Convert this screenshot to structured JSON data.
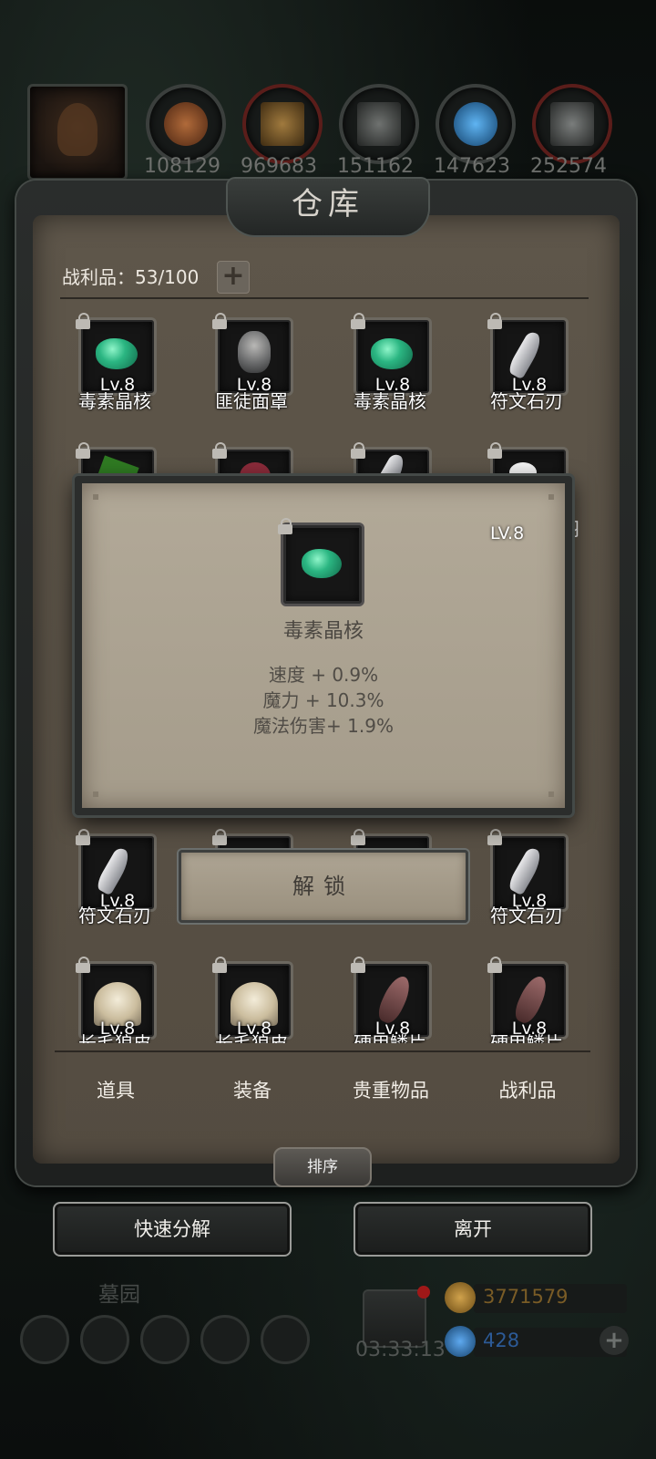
{
  "resources": [
    {
      "value": "108129",
      "color": "#8a4a26"
    },
    {
      "value": "969683",
      "color": "#8a6a34"
    },
    {
      "value": "151162",
      "color": "#555856"
    },
    {
      "value": "147623",
      "color": "#2a6fa8"
    },
    {
      "value": "252574",
      "color": "#4a4d4c"
    }
  ],
  "warehouse": {
    "title": "仓库",
    "capacity_label": "战利品：53/100",
    "add_capacity": "+"
  },
  "grid": {
    "rows": [
      {
        "items": [
          {
            "name": "毒素晶核",
            "level": "Lv.8",
            "type": "gem"
          },
          {
            "name": "匪徒面罩",
            "level": "Lv.8",
            "type": "mask"
          },
          {
            "name": "毒素晶核",
            "level": "Lv.8",
            "type": "gem"
          },
          {
            "name": "符文石刃",
            "level": "Lv.8",
            "type": "blade"
          }
        ]
      },
      {
        "items": [
          {
            "name": "符文石刃",
            "level": "Lv.8",
            "type": "blade"
          },
          {
            "name": "",
            "level": "",
            "type": "hidden"
          },
          {
            "name": "",
            "level": "",
            "type": "hidden"
          },
          {
            "name": "符文石刃",
            "level": "Lv.8",
            "type": "blade"
          }
        ]
      },
      {
        "items": [
          {
            "name": "长毛狼皮",
            "level": "Lv.8",
            "type": "fur"
          },
          {
            "name": "长毛狼皮",
            "level": "Lv.8",
            "type": "fur"
          },
          {
            "name": "硬甲鳞片",
            "level": "Lv.8",
            "type": "scale"
          },
          {
            "name": "硬甲鳞片",
            "level": "Lv.8",
            "type": "scale"
          }
        ]
      }
    ],
    "partial_right_label": "羽"
  },
  "tabs": [
    "道具",
    "装备",
    "贵重物品",
    "战利品"
  ],
  "sort_label": "排序",
  "actions": {
    "quick_decompose": "快速分解",
    "leave": "离开"
  },
  "hud": {
    "area_name": "墓园",
    "timer": "03:33:13",
    "gold": "3771579",
    "gems": "428",
    "plus": "+",
    "gold_color": "#8a6a2a",
    "gem_color": "#1f4f86"
  },
  "modal": {
    "level": "LV.8",
    "item_name": "毒素晶核",
    "stats": [
      "速度 + 0.9%",
      "魔力 + 10.3%",
      "魔法伤害+ 1.9%"
    ],
    "unlock_label": "解锁"
  }
}
